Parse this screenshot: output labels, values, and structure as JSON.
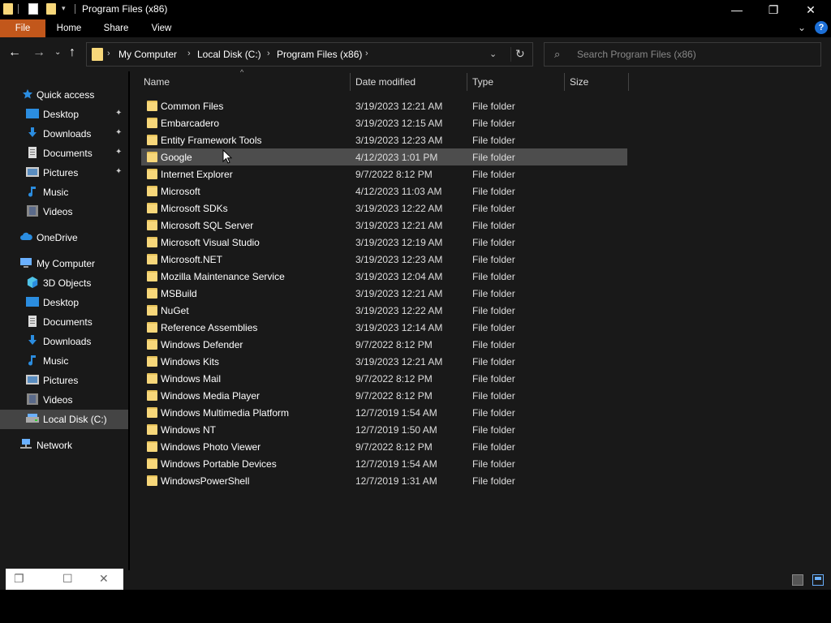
{
  "window": {
    "title": "Program Files (x86)",
    "controls": {
      "minimize": "—",
      "maximize": "❐",
      "close": "✕"
    },
    "qa_dropdown": "▾"
  },
  "ribbon": {
    "tabs": [
      {
        "label": "File",
        "active": true,
        "color": "#c2571b"
      },
      {
        "label": "Home"
      },
      {
        "label": "Share"
      },
      {
        "label": "View"
      }
    ],
    "expand_glyph": "⌄",
    "help": "?"
  },
  "navigation": {
    "back": "←",
    "forward": "→",
    "recent": "⌄",
    "up": "↑"
  },
  "address": {
    "breadcrumbs": [
      "My Computer",
      "Local Disk (C:)",
      "Program Files (x86)"
    ],
    "separator": "›",
    "dropdown": "⌄",
    "refresh": "↻"
  },
  "search": {
    "placeholder": "Search Program Files (x86)",
    "icon": "⌕"
  },
  "nav_pane": {
    "quick_access": "Quick access",
    "quick_items": [
      {
        "label": "Desktop",
        "icon": "desktop-icon",
        "pinned": true
      },
      {
        "label": "Downloads",
        "icon": "download-icon",
        "pinned": true
      },
      {
        "label": "Documents",
        "icon": "documents-icon",
        "pinned": true
      },
      {
        "label": "Pictures",
        "icon": "pictures-icon",
        "pinned": true
      },
      {
        "label": "Music",
        "icon": "music-icon",
        "pinned": false
      },
      {
        "label": "Videos",
        "icon": "videos-icon",
        "pinned": false
      }
    ],
    "onedrive": "OneDrive",
    "my_computer": "My Computer",
    "computer_items": [
      {
        "label": "3D Objects",
        "icon": "3d-objects-icon"
      },
      {
        "label": "Desktop",
        "icon": "desktop-icon"
      },
      {
        "label": "Documents",
        "icon": "documents-icon"
      },
      {
        "label": "Downloads",
        "icon": "download-icon"
      },
      {
        "label": "Music",
        "icon": "music-icon"
      },
      {
        "label": "Pictures",
        "icon": "pictures-icon"
      },
      {
        "label": "Videos",
        "icon": "videos-icon"
      },
      {
        "label": "Local Disk (C:)",
        "icon": "drive-icon",
        "selected": true
      }
    ],
    "network": "Network",
    "pin_glyph": "📌"
  },
  "file_list": {
    "columns": {
      "name": "Name",
      "date": "Date modified",
      "type": "Type",
      "size": "Size"
    },
    "sort_glyph": "^",
    "rows": [
      {
        "name": "Common Files",
        "date": "3/19/2023 12:21 AM",
        "type": "File folder"
      },
      {
        "name": "Embarcadero",
        "date": "3/19/2023 12:15 AM",
        "type": "File folder"
      },
      {
        "name": "Entity Framework Tools",
        "date": "3/19/2023 12:23 AM",
        "type": "File folder"
      },
      {
        "name": "Google",
        "date": "4/12/2023 1:01 PM",
        "type": "File folder",
        "hover": true
      },
      {
        "name": "Internet Explorer",
        "date": "9/7/2022 8:12 PM",
        "type": "File folder"
      },
      {
        "name": "Microsoft",
        "date": "4/12/2023 11:03 AM",
        "type": "File folder"
      },
      {
        "name": "Microsoft SDKs",
        "date": "3/19/2023 12:22 AM",
        "type": "File folder"
      },
      {
        "name": "Microsoft SQL Server",
        "date": "3/19/2023 12:21 AM",
        "type": "File folder"
      },
      {
        "name": "Microsoft Visual Studio",
        "date": "3/19/2023 12:19 AM",
        "type": "File folder"
      },
      {
        "name": "Microsoft.NET",
        "date": "3/19/2023 12:23 AM",
        "type": "File folder"
      },
      {
        "name": "Mozilla Maintenance Service",
        "date": "3/19/2023 12:04 AM",
        "type": "File folder"
      },
      {
        "name": "MSBuild",
        "date": "3/19/2023 12:21 AM",
        "type": "File folder"
      },
      {
        "name": "NuGet",
        "date": "3/19/2023 12:22 AM",
        "type": "File folder"
      },
      {
        "name": "Reference Assemblies",
        "date": "3/19/2023 12:14 AM",
        "type": "File folder"
      },
      {
        "name": "Windows Defender",
        "date": "9/7/2022 8:12 PM",
        "type": "File folder"
      },
      {
        "name": "Windows Kits",
        "date": "3/19/2023 12:21 AM",
        "type": "File folder"
      },
      {
        "name": "Windows Mail",
        "date": "9/7/2022 8:12 PM",
        "type": "File folder"
      },
      {
        "name": "Windows Media Player",
        "date": "9/7/2022 8:12 PM",
        "type": "File folder"
      },
      {
        "name": "Windows Multimedia Platform",
        "date": "12/7/2019 1:54 AM",
        "type": "File folder"
      },
      {
        "name": "Windows NT",
        "date": "12/7/2019 1:50 AM",
        "type": "File folder"
      },
      {
        "name": "Windows Photo Viewer",
        "date": "9/7/2022 8:12 PM",
        "type": "File folder"
      },
      {
        "name": "Windows Portable Devices",
        "date": "12/7/2019 1:54 AM",
        "type": "File folder"
      },
      {
        "name": "WindowsPowerShell",
        "date": "12/7/2019 1:31 AM",
        "type": "File folder"
      }
    ]
  },
  "mini_window": {
    "restore": "❐",
    "maximize": "☐",
    "close": "✕"
  },
  "colors": {
    "background": "#191919",
    "accent_file_tab": "#c2571b",
    "folder_yellow": "#f7d77a",
    "hover_row": "#4d4d4d",
    "selected_nav": "#444444"
  }
}
